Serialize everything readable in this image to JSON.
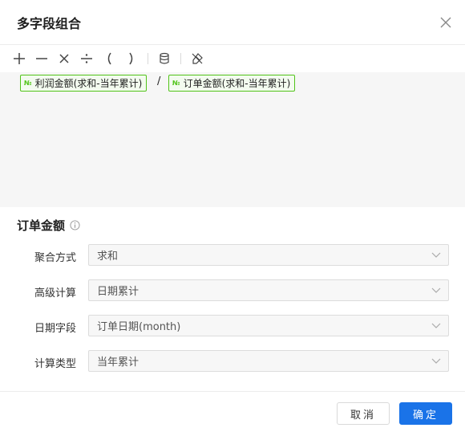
{
  "dialog": {
    "title": "多字段组合",
    "close_icon": "close-icon"
  },
  "toolbar": {
    "buttons": [
      {
        "name": "plus-button",
        "symbol": "+"
      },
      {
        "name": "minus-button",
        "symbol": "—"
      },
      {
        "name": "multiply-button",
        "symbol": "×"
      },
      {
        "name": "divide-button",
        "symbol": "÷"
      },
      {
        "name": "left-paren-button",
        "symbol": "("
      },
      {
        "name": "right-paren-button",
        "symbol": ")"
      }
    ],
    "icons": [
      "database-icon",
      "clear-format-icon"
    ]
  },
  "formula": {
    "tokens": [
      {
        "icon": "№",
        "label": "利润金额(求和-当年累计)"
      },
      {
        "icon": "№",
        "label": "订单金额(求和-当年累计)"
      }
    ],
    "operator": "/"
  },
  "config": {
    "title": "订单金额",
    "rows": [
      {
        "label": "聚合方式",
        "value": "求和"
      },
      {
        "label": "高级计算",
        "value": "日期累计"
      },
      {
        "label": "日期字段",
        "value": "订单日期(month)"
      },
      {
        "label": "计算类型",
        "value": "当年累计"
      }
    ]
  },
  "footer": {
    "cancel_label": "取消",
    "ok_label": "确定"
  },
  "colors": {
    "primary": "#1a73e8",
    "token_border": "#52c41a",
    "editor_bg": "#f6f6f6"
  }
}
